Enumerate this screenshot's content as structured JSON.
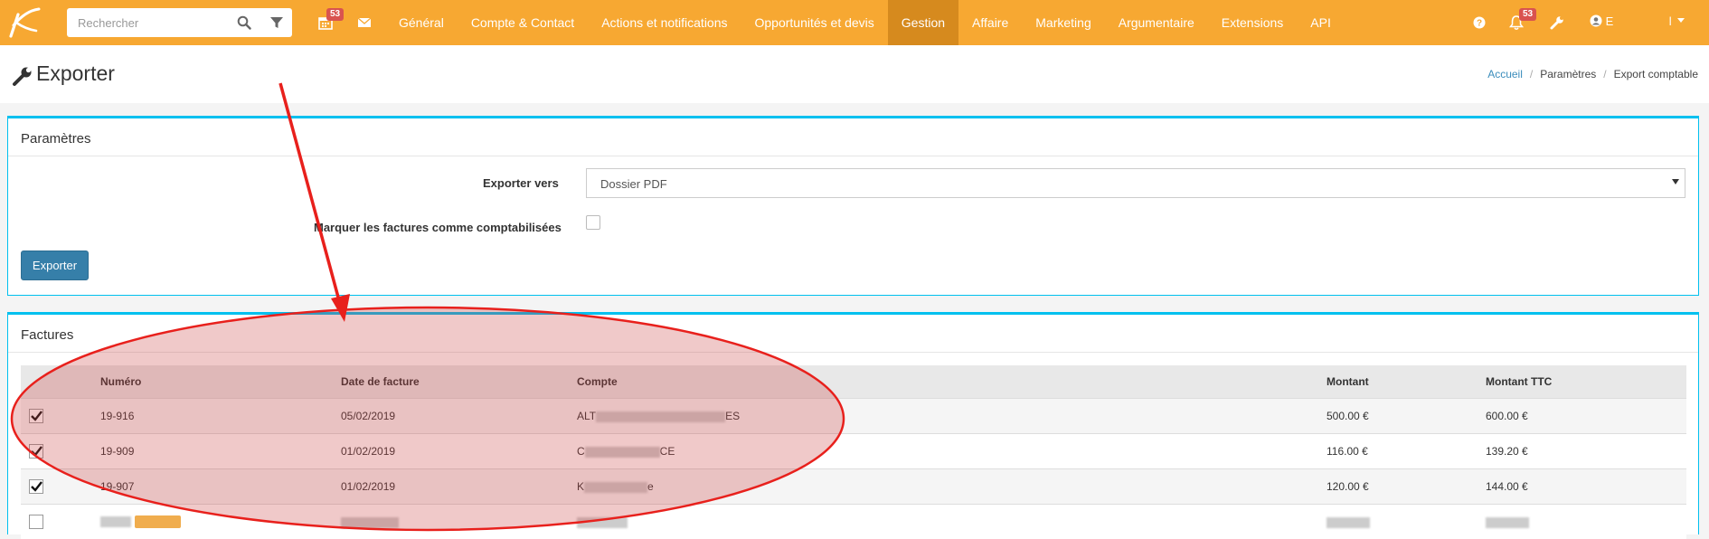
{
  "topbar": {
    "search_placeholder": "Rechercher",
    "calendar_badge": "53",
    "notifications_badge": "53",
    "user_name": "E                 l",
    "nav": [
      {
        "label": "Général"
      },
      {
        "label": "Compte & Contact"
      },
      {
        "label": "Actions et notifications"
      },
      {
        "label": "Opportunités et devis"
      },
      {
        "label": "Gestion",
        "active": true
      },
      {
        "label": "Affaire"
      },
      {
        "label": "Marketing"
      },
      {
        "label": "Argumentaire"
      },
      {
        "label": "Extensions"
      },
      {
        "label": "API"
      }
    ]
  },
  "page": {
    "title": "Exporter",
    "breadcrumb": [
      "Accueil",
      "Paramètres",
      "Export comptable"
    ]
  },
  "params": {
    "title": "Paramètres",
    "export_label": "Exporter vers",
    "export_value": "Dossier PDF",
    "mark_label": "Marquer les factures comme comptabilisées",
    "mark_checked": false,
    "button": "Exporter"
  },
  "invoices": {
    "title": "Factures",
    "columns": [
      "Numéro",
      "Date de facture",
      "Compte",
      "Montant",
      "Montant TTC"
    ],
    "rows": [
      {
        "numero": "19-916",
        "date": "05/02/2019",
        "compte_start": "ALT",
        "compte_end": "ES",
        "montant": "500.00 €",
        "ttc": "600.00 €",
        "checked": true
      },
      {
        "numero": "19-909",
        "date": "01/02/2019",
        "compte_start": "C",
        "compte_end": "CE",
        "montant": "116.00 €",
        "ttc": "139.20 €",
        "checked": true
      },
      {
        "numero": "19-907",
        "date": "01/02/2019",
        "compte_start": "K",
        "compte_end": "e",
        "montant": "120.00 €",
        "ttc": "144.00 €",
        "checked": true
      }
    ]
  },
  "colors": {
    "topbar": "#f7a832",
    "nav_active": "#d68a1e",
    "panel_border": "#00c0ef",
    "button": "#367fa9",
    "annotation": "#e8201c"
  },
  "icons": [
    "logo-icon",
    "search-icon",
    "filter-icon",
    "calendar-icon",
    "envelope-icon",
    "help-icon",
    "bell-icon",
    "wrench-icon",
    "user-icon",
    "check-icon"
  ]
}
